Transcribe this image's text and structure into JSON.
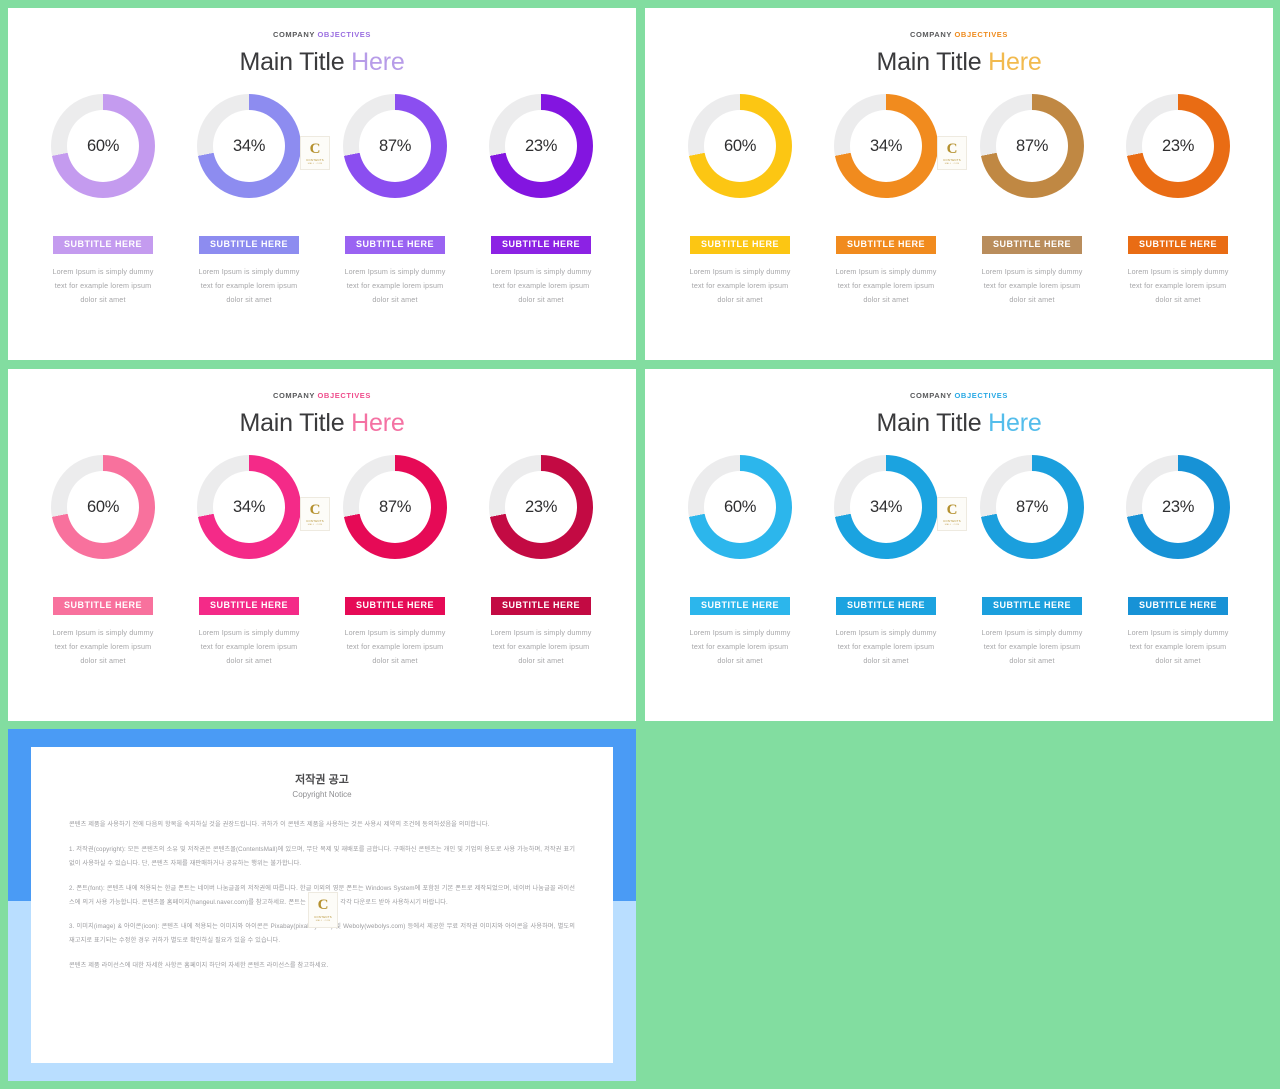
{
  "slides": [
    {
      "id": "purple",
      "eyebrow_1": "COMPANY",
      "eyebrow_2": "OBJECTIVES",
      "title_1": "Main Title",
      "title_2": "Here",
      "accent": "#a98ae0",
      "title_accent": "#b79ce8",
      "track": "#ececed",
      "charts": [
        {
          "pct": "60%",
          "color": "#c49bef",
          "badge": "SUBTITLE HERE",
          "badge_color": "#c49bef",
          "desc_1": "Lorem  Ipsum  is  simply  dummy",
          "desc_2": "text for example lorem ipsum",
          "desc_3": "dolor sit amet"
        },
        {
          "pct": "34%",
          "color": "#8d8cf0",
          "badge": "SUBTITLE HERE",
          "badge_color": "#8d8cf0",
          "desc_1": "Lorem  Ipsum  is  simply  dummy",
          "desc_2": "text for example lorem ipsum",
          "desc_3": "dolor sit amet"
        },
        {
          "pct": "87%",
          "color": "#8b4ef0",
          "badge": "SUBTITLE HERE",
          "badge_color": "#9a63f2",
          "desc_1": "Lorem  Ipsum  is  simply  dummy",
          "desc_2": "text for example lorem ipsum",
          "desc_3": "dolor sit amet"
        },
        {
          "pct": "23%",
          "color": "#8315e0",
          "badge": "SUBTITLE HERE",
          "badge_color": "#8c22e4",
          "desc_1": "Lorem  Ipsum  is  simply  dummy",
          "desc_2": "text for example lorem ipsum",
          "desc_3": "dolor sit amet"
        }
      ]
    },
    {
      "id": "orange",
      "eyebrow_1": "COMPANY",
      "eyebrow_2": "OBJECTIVES",
      "title_1": "Main Title",
      "title_2": "Here",
      "accent": "#ef8c1f",
      "title_accent": "#f2ba4e",
      "track": "#ececed",
      "charts": [
        {
          "pct": "60%",
          "color": "#fcc613",
          "badge": "SUBTITLE HERE",
          "badge_color": "#fcc613",
          "desc_1": "Lorem  Ipsum  is  simply  dummy",
          "desc_2": "text for example lorem ipsum",
          "desc_3": "dolor sit amet"
        },
        {
          "pct": "34%",
          "color": "#f18b1e",
          "badge": "SUBTITLE HERE",
          "badge_color": "#f18b1e",
          "desc_1": "Lorem  Ipsum  is  simply  dummy",
          "desc_2": "text for example lorem ipsum",
          "desc_3": "dolor sit amet"
        },
        {
          "pct": "87%",
          "color": "#c08843",
          "badge": "SUBTITLE HERE",
          "badge_color": "#b98d5c",
          "desc_1": "Lorem  Ipsum  is  simply  dummy",
          "desc_2": "text for example lorem ipsum",
          "desc_3": "dolor sit amet"
        },
        {
          "pct": "23%",
          "color": "#e96c14",
          "badge": "SUBTITLE HERE",
          "badge_color": "#e96c14",
          "desc_1": "Lorem  Ipsum  is  simply  dummy",
          "desc_2": "text for example lorem ipsum",
          "desc_3": "dolor sit amet"
        }
      ]
    },
    {
      "id": "pink",
      "eyebrow_1": "COMPANY",
      "eyebrow_2": "OBJECTIVES",
      "title_1": "Main Title",
      "title_2": "Here",
      "accent": "#ef4d8c",
      "title_accent": "#f472a3",
      "track": "#ececed",
      "charts": [
        {
          "pct": "60%",
          "color": "#f8719d",
          "badge": "SUBTITLE HERE",
          "badge_color": "#f8719d",
          "desc_1": "Lorem  Ipsum  is  simply  dummy",
          "desc_2": "text for example lorem ipsum",
          "desc_3": "dolor sit amet"
        },
        {
          "pct": "34%",
          "color": "#f42a88",
          "badge": "SUBTITLE HERE",
          "badge_color": "#f42a88",
          "desc_1": "Lorem  Ipsum  is  simply  dummy",
          "desc_2": "text for example lorem ipsum",
          "desc_3": "dolor sit amet"
        },
        {
          "pct": "87%",
          "color": "#e60a56",
          "badge": "SUBTITLE HERE",
          "badge_color": "#e60a56",
          "desc_1": "Lorem  Ipsum  is  simply  dummy",
          "desc_2": "text for example lorem ipsum",
          "desc_3": "dolor sit amet"
        },
        {
          "pct": "23%",
          "color": "#c30a43",
          "badge": "SUBTITLE HERE",
          "badge_color": "#c30a43",
          "desc_1": "Lorem  Ipsum  is  simply  dummy",
          "desc_2": "text for example lorem ipsum",
          "desc_3": "dolor sit amet"
        }
      ]
    },
    {
      "id": "blue",
      "eyebrow_1": "COMPANY",
      "eyebrow_2": "OBJECTIVES",
      "title_1": "Main Title",
      "title_2": "Here",
      "accent": "#29a9e5",
      "title_accent": "#54bdeb",
      "track": "#ececed",
      "charts": [
        {
          "pct": "60%",
          "color": "#2cb6ec",
          "badge": "SUBTITLE HERE",
          "badge_color": "#2cb6ec",
          "desc_1": "Lorem  Ipsum  is  simply  dummy",
          "desc_2": "text for example lorem ipsum",
          "desc_3": "dolor sit amet"
        },
        {
          "pct": "34%",
          "color": "#1ba3e0",
          "badge": "SUBTITLE HERE",
          "badge_color": "#1ba3e0",
          "desc_1": "Lorem  Ipsum  is  simply  dummy",
          "desc_2": "text for example lorem ipsum",
          "desc_3": "dolor sit amet"
        },
        {
          "pct": "87%",
          "color": "#1b9fdd",
          "badge": "SUBTITLE HERE",
          "badge_color": "#1b9fdd",
          "desc_1": "Lorem  Ipsum  is  simply  dummy",
          "desc_2": "text for example lorem ipsum",
          "desc_3": "dolor sit amet"
        },
        {
          "pct": "23%",
          "color": "#1792d6",
          "badge": "SUBTITLE HERE",
          "badge_color": "#1792d6",
          "desc_1": "Lorem  Ipsum  is  simply  dummy",
          "desc_2": "text for example lorem ipsum",
          "desc_3": "dolor sit amet"
        }
      ]
    }
  ],
  "watermark": {
    "letter": "C",
    "line_1": "CONTENTS",
    "line_2": "MALL . COM"
  },
  "copyright": {
    "title_ko": "저작권 공고",
    "title_en": "Copyright Notice",
    "p_intro": "콘텐츠 제품을 사용하기 전에 다음의 항목을 숙지하실 것을 권장드립니다. 귀하가 이 콘텐츠 제품을 사용하는 것은 사용시 제약의 조건에 동의하셨음을 의미합니다.",
    "p_1": "1. 저작권(copyright): 모든 콘텐츠의 소유 및 저작권은 콘텐츠몰(ContentsMall)에 있으며, 무단 복제 및 재배포를 금합니다. 구매하신 콘텐츠는 개인 및 기업의 용도로 사용 가능하며, 저작권 표기 없이 사용하실 수 있습니다. 단, 콘텐츠 자체를 재판매하거나 공유하는 행위는 불가합니다.",
    "p_2": "2. 폰트(font): 콘텐츠 내에 적용되는 한글 폰트는 네이버 나눔글꼴의 저작권에 따릅니다. 한글 이외의 영문 폰트는 Windows System에 포함된 기본 폰트로 제작되었으며, 네이버 나눔글꼴 라이선스에 의거 사용 가능합니다. 콘텐츠몰 홈페이지(hangeul.naver.com)를 참고하세요. 폰트는 필요한 경우 각각 다운로드 받아 사용하시기 바랍니다.",
    "p_3": "3. 이미지(image) & 아이콘(icon): 콘텐츠 내에 적용되는 이미지와 아이콘은 Pixabay(pixabay.com) 및 Weboly(webolys.com) 등에서 제공한 무료 저작권 이미지와 아이콘을 사용하며, 별도의 재고지로 표기되는 수정한 경우 귀하가 별도로 확인하실 필요가 있을 수 있습니다.",
    "p_outro": "콘텐츠 제품 라이선스에 대한 자세한 사항은 홈페이지 하단의 자세한 콘텐츠 라이선스를 참고하세요."
  }
}
